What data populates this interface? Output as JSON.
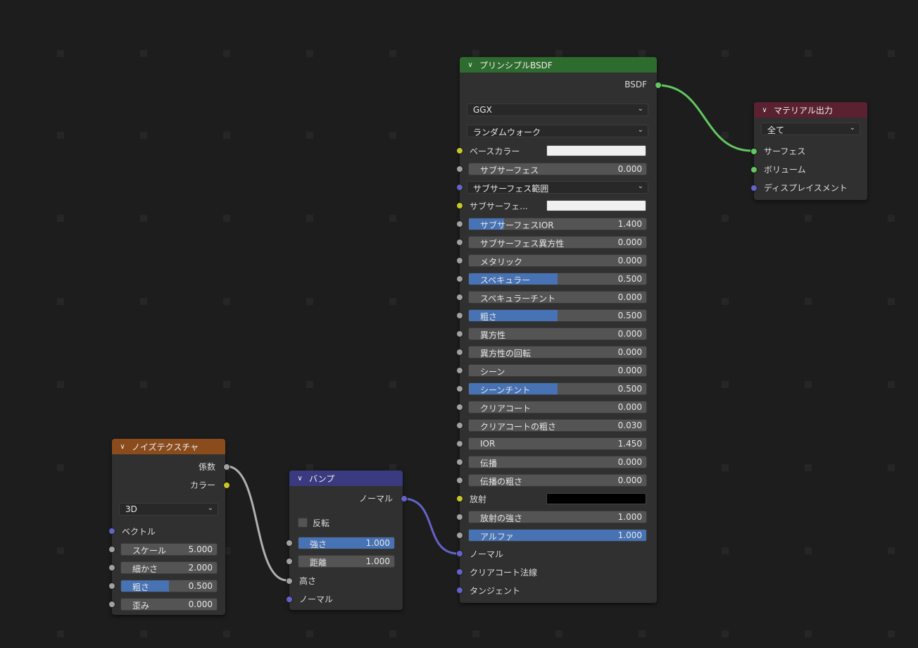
{
  "colors": {
    "background": "#1d1d1d",
    "node_body": "#303030",
    "header_shader": "#2e6b2e",
    "header_output": "#5a2230",
    "header_texture": "#8a4c1d",
    "header_vector": "#3a3a80",
    "slider_fill": "#4772b3",
    "socket_shader": "#63c763",
    "socket_color": "#c7c729",
    "socket_vector": "#6363c7",
    "socket_float": "#a1a1a1"
  },
  "principled": {
    "title": "プリンシプルBSDF",
    "output": "BSDF",
    "distribution": "GGX",
    "subsurface_method": "ランダムウォーク",
    "base_color_label": "ベースカラー",
    "base_color": "#f0f0f0",
    "subsurface": {
      "label": "サブサーフェス",
      "value": "0.000",
      "fill": 0
    },
    "subsurface_radius": "サブサーフェス範囲",
    "subsurface_color_label": "サブサーフェ...",
    "subsurface_color": "#f0f0f0",
    "fields": [
      {
        "label": "サブサーフェスIOR",
        "value": "1.400",
        "fill": 0.2
      },
      {
        "label": "サブサーフェス異方性",
        "value": "0.000",
        "fill": 0
      },
      {
        "label": "メタリック",
        "value": "0.000",
        "fill": 0
      },
      {
        "label": "スペキュラー",
        "value": "0.500",
        "fill": 0.5
      },
      {
        "label": "スペキュラーチント",
        "value": "0.000",
        "fill": 0
      },
      {
        "label": "粗さ",
        "value": "0.500",
        "fill": 0.5
      },
      {
        "label": "異方性",
        "value": "0.000",
        "fill": 0
      },
      {
        "label": "異方性の回転",
        "value": "0.000",
        "fill": 0
      },
      {
        "label": "シーン",
        "value": "0.000",
        "fill": 0
      },
      {
        "label": "シーンチント",
        "value": "0.500",
        "fill": 0.5
      },
      {
        "label": "クリアコート",
        "value": "0.000",
        "fill": 0
      },
      {
        "label": "クリアコートの粗さ",
        "value": "0.030",
        "fill": 0
      },
      {
        "label": "IOR",
        "value": "1.450",
        "fill": 0
      },
      {
        "label": "伝播",
        "value": "0.000",
        "fill": 0
      },
      {
        "label": "伝播の粗さ",
        "value": "0.000",
        "fill": 0
      }
    ],
    "emission_label": "放射",
    "emission_color": "#000000",
    "emission_strength": {
      "label": "放射の強さ",
      "value": "1.000",
      "fill": 0
    },
    "alpha": {
      "label": "アルファ",
      "value": "1.000",
      "fill": 1
    },
    "normal": "ノーマル",
    "clearcoat_normal": "クリアコート法線",
    "tangent": "タンジェント"
  },
  "material_output": {
    "title": "マテリアル出力",
    "target": "全て",
    "surface": "サーフェス",
    "volume": "ボリューム",
    "displacement": "ディスプレイスメント"
  },
  "noise": {
    "title": "ノイズテクスチャ",
    "out_fac": "係数",
    "out_color": "カラー",
    "dimensions": "3D",
    "vector": "ベクトル",
    "fields": [
      {
        "label": "スケール",
        "value": "5.000",
        "fill": 0
      },
      {
        "label": "細かさ",
        "value": "2.000",
        "fill": 0
      },
      {
        "label": "粗さ",
        "value": "0.500",
        "fill": 0.5
      },
      {
        "label": "歪み",
        "value": "0.000",
        "fill": 0
      }
    ]
  },
  "bump": {
    "title": "バンプ",
    "out_normal": "ノーマル",
    "invert": "反転",
    "fields": [
      {
        "label": "強さ",
        "value": "1.000",
        "fill": 1
      },
      {
        "label": "距離",
        "value": "1.000",
        "fill": 0
      }
    ],
    "height": "高さ",
    "normal": "ノーマル"
  }
}
